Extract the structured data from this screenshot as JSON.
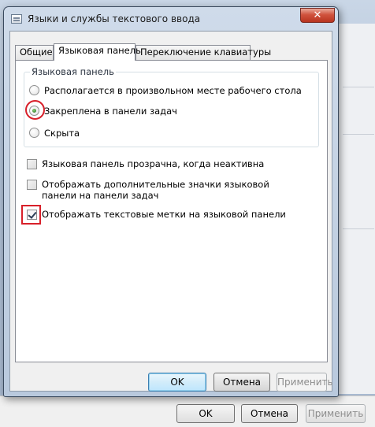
{
  "dialog": {
    "title": "Языки и службы текстового ввода",
    "close_label": "✕"
  },
  "tabs": [
    {
      "label": "Общие",
      "active": false
    },
    {
      "label": "Языковая панель",
      "active": true
    },
    {
      "label": "Переключение клавиатуры",
      "active": false
    }
  ],
  "language_bar_group": {
    "legend": "Языковая панель",
    "options": [
      {
        "label": "Располагается в произвольном месте рабочего стола",
        "checked": false
      },
      {
        "label": "Закреплена в панели задач",
        "checked": true
      },
      {
        "label": "Скрыта",
        "checked": false
      }
    ]
  },
  "checkboxes": [
    {
      "label": "Языковая панель прозрачна, когда неактивна",
      "checked": false
    },
    {
      "label": "Отображать дополнительные значки языковой панели на панели задач",
      "checked": false
    },
    {
      "label": "Отображать текстовые метки на языковой панели",
      "checked": true
    }
  ],
  "buttons": {
    "ok": "OK",
    "cancel": "Отмена",
    "apply": "Применить"
  },
  "background_buttons": {
    "ok": "OK",
    "cancel": "Отмена",
    "apply": "Применить"
  },
  "colors": {
    "annotation_red": "#d8202a",
    "radio_selected": "#1f6b17"
  }
}
